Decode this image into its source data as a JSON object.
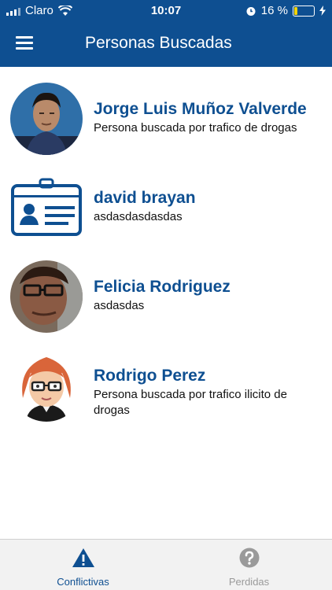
{
  "status_bar": {
    "carrier": "Claro",
    "time": "10:07",
    "battery": "16 %"
  },
  "header": {
    "title": "Personas Buscadas",
    "menu_icon": "hamburger-menu-icon"
  },
  "people": [
    {
      "name": "Jorge Luis Muñoz Valverde",
      "description": "Persona buscada por trafico de drogas"
    },
    {
      "name": "david brayan",
      "description": "asdasdasdasdas"
    },
    {
      "name": "Felicia Rodriguez",
      "description": "asdasdas"
    },
    {
      "name": "Rodrigo Perez",
      "description": "Persona buscada por trafico ilicito de drogas"
    }
  ],
  "tabs": [
    {
      "label": "Conflictivas",
      "icon": "warning-triangle-icon",
      "active": true
    },
    {
      "label": "Perdidas",
      "icon": "question-circle-icon",
      "active": false
    }
  ],
  "colors": {
    "primary": "#0e4f91",
    "inactive": "#9a9a9a",
    "tabbar_bg": "#f2f2f2"
  }
}
